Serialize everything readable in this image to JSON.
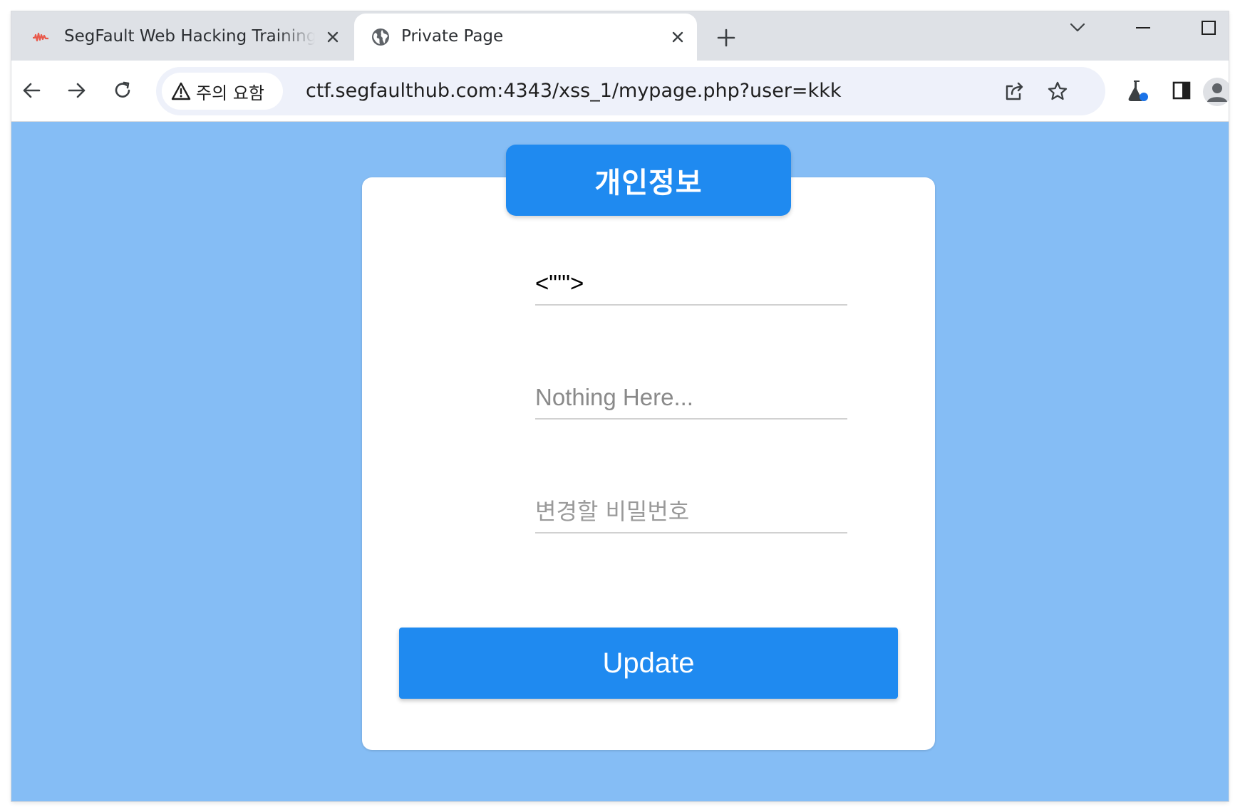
{
  "tabs": [
    {
      "title": "SegFault Web Hacking Training",
      "favicon": "segfault-logo-icon",
      "close_icon": "close-icon"
    },
    {
      "title": "Private Page",
      "favicon": "globe-icon",
      "close_icon": "close-icon"
    }
  ],
  "window_controls": [
    "chevron-down-icon",
    "minimize-icon",
    "maximize-icon"
  ],
  "toolbar": {
    "security_chip": "주의 요함",
    "url": "ctf.segfaulthub.com:4343/xss_1/mypage.php?user=kkk"
  },
  "page": {
    "header_title": "개인정보",
    "fields": {
      "username_value": "<\"'\">",
      "info_placeholder": "Nothing Here...",
      "password_placeholder": "변경할 비밀번호"
    },
    "update_label": "Update"
  },
  "colors": {
    "page_background": "#85bdf5",
    "accent": "#1f8af0",
    "card": "#ffffff"
  }
}
